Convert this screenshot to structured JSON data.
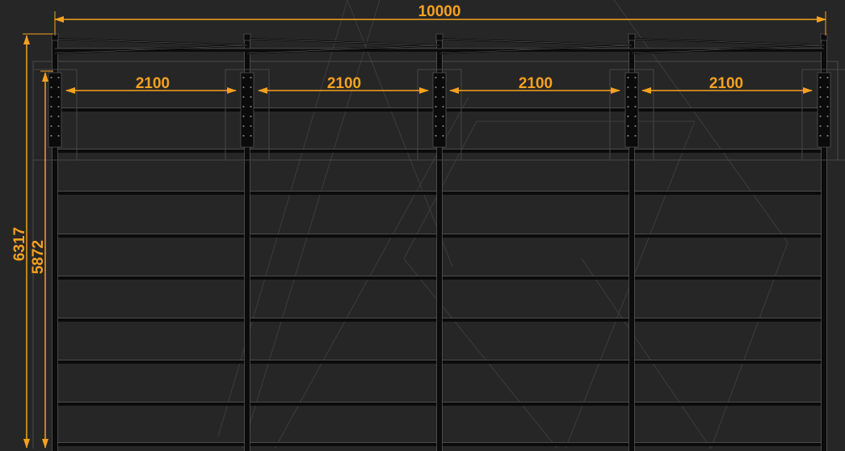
{
  "dimensions": {
    "overall_width": "10000",
    "bay_spacings": [
      "2100",
      "2100",
      "2100",
      "2100"
    ],
    "overall_depth": "6317",
    "inner_depth": "5872"
  },
  "colors": {
    "background": "#262626",
    "dimension": "#f5a11f",
    "structure": "#0b0b0b",
    "structure_highlight": "#5a5a5a",
    "watermark": "#3a3a3a"
  },
  "structure": {
    "posts": 5,
    "horizontal_beams": 9
  }
}
